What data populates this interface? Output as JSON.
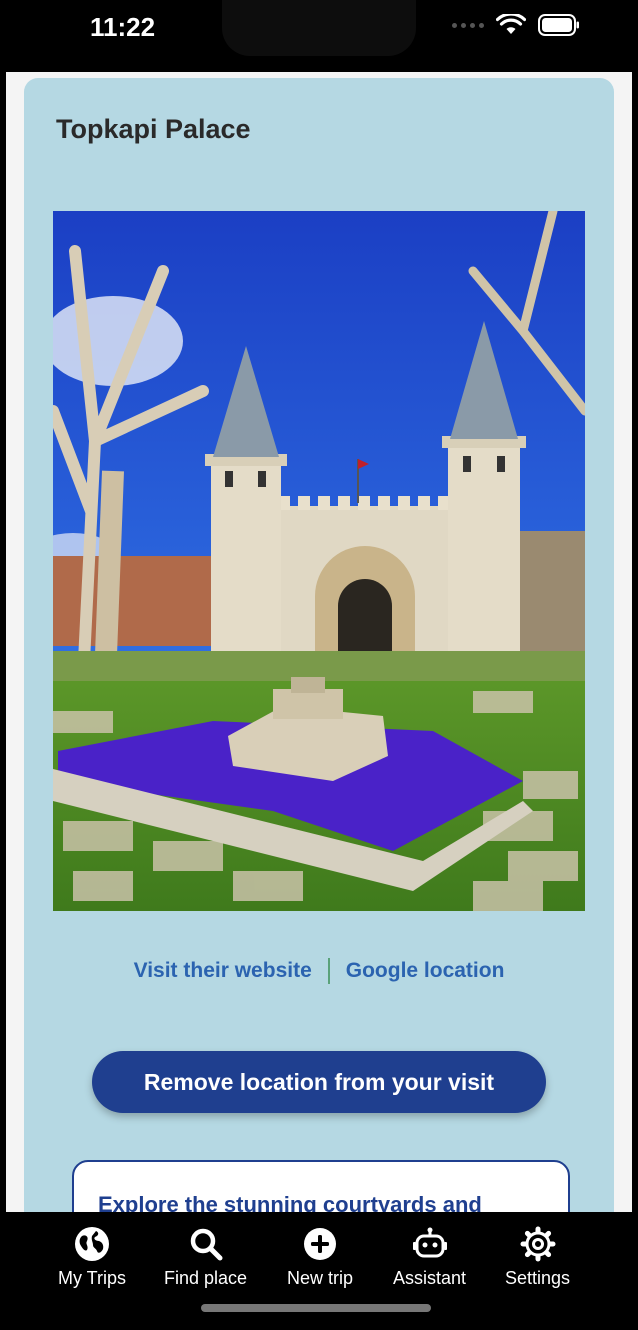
{
  "status": {
    "time": "11:22"
  },
  "place": {
    "title": "Topkapi Palace"
  },
  "gallery": {
    "active_index": 0,
    "count": 6
  },
  "links": {
    "website": "Visit their website",
    "location": "Google location"
  },
  "actions": {
    "remove": "Remove location from your visit"
  },
  "description": {
    "text": "Explore the stunning courtyards and"
  },
  "tabs": [
    {
      "label": "My Trips",
      "icon": "globe-icon"
    },
    {
      "label": "Find place",
      "icon": "search-icon"
    },
    {
      "label": "New trip",
      "icon": "plus-circle-icon"
    },
    {
      "label": "Assistant",
      "icon": "robot-icon"
    },
    {
      "label": "Settings",
      "icon": "gear-icon"
    }
  ],
  "colors": {
    "card_bg": "#b5d8e3",
    "primary": "#1f3f8f",
    "link": "#2b63b0",
    "dot_active": "#2f7de1"
  }
}
